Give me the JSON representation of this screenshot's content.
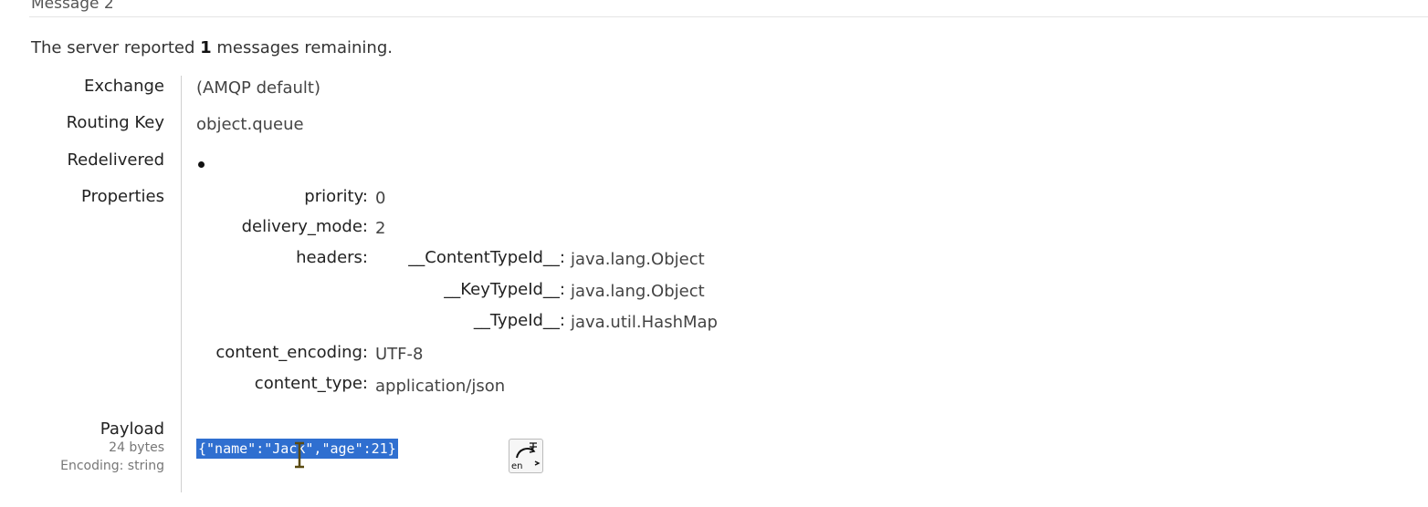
{
  "message": {
    "title": "Message 2",
    "summary_prefix": "The server reported ",
    "remaining_count": "1",
    "summary_suffix": " messages remaining."
  },
  "fields": {
    "exchange_label": "Exchange",
    "exchange_value": "(AMQP default)",
    "routing_key_label": "Routing Key",
    "routing_key_value": "object.queue",
    "redelivered_label": "Redelivered",
    "properties_label": "Properties"
  },
  "properties": {
    "priority_key": "priority:",
    "priority_value": "0",
    "delivery_mode_key": "delivery_mode:",
    "delivery_mode_value": "2",
    "headers_key": "headers:",
    "headers": [
      {
        "key": "__ContentTypeId__:",
        "value": "java.lang.Object"
      },
      {
        "key": "__KeyTypeId__:",
        "value": "java.lang.Object"
      },
      {
        "key": "__TypeId__:",
        "value": "java.util.HashMap"
      }
    ],
    "content_encoding_key": "content_encoding:",
    "content_encoding_value": "UTF-8",
    "content_type_key": "content_type:",
    "content_type_value": "application/json"
  },
  "payload": {
    "label": "Payload",
    "size": "24 bytes",
    "encoding": "Encoding: string",
    "content": "{\"name\":\"Jack\",\"age\":21}"
  },
  "icons": {
    "redelivered_marker": "bullet-dot-icon",
    "translate": "translate-icon",
    "text_cursor": "text-cursor-icon",
    "translate_text": "en"
  },
  "colors": {
    "selection": "#2f6fd0",
    "divider": "#cfcfcf"
  }
}
